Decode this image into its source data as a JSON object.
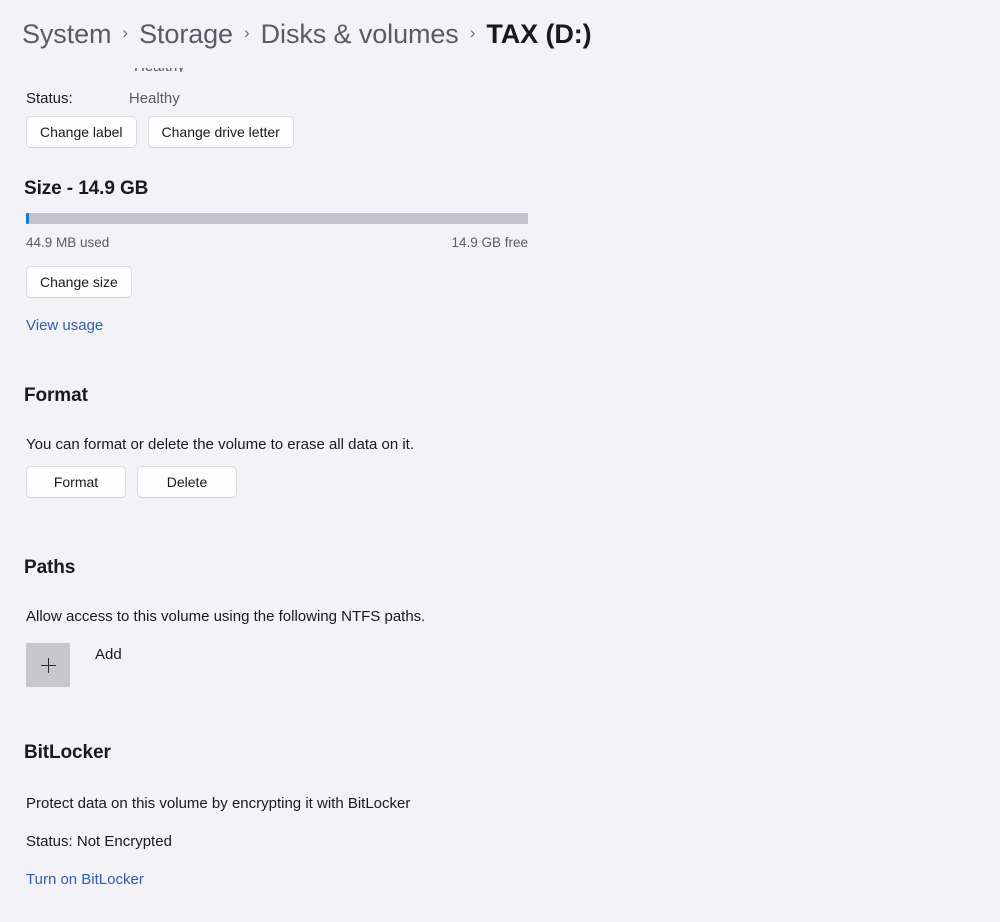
{
  "breadcrumb": {
    "separator": "›",
    "items": [
      {
        "label": "System",
        "current": false
      },
      {
        "label": "Storage",
        "current": false
      },
      {
        "label": "Disks & volumes",
        "current": false
      },
      {
        "label": "TAX (D:)",
        "current": true
      }
    ]
  },
  "volume": {
    "status_label": "Status:",
    "status_value": "Healthy",
    "change_label_button": "Change label",
    "change_drive_letter_button": "Change drive letter"
  },
  "size": {
    "heading": "Size - 14.9 GB",
    "total": "14.9 GB",
    "used_text": "44.9 MB used",
    "free_text": "14.9 GB free",
    "used_percent": 0.3,
    "change_size_button": "Change size",
    "view_usage_link": "View usage"
  },
  "format": {
    "heading": "Format",
    "description": "You can format or delete the volume to erase all data on it.",
    "format_button": "Format",
    "delete_button": "Delete"
  },
  "paths": {
    "heading": "Paths",
    "description": "Allow access to this volume using the following NTFS paths.",
    "add_label": "Add"
  },
  "bitlocker": {
    "heading": "BitLocker",
    "description": "Protect data on this volume by encrypting it with BitLocker",
    "status": "Status: Not Encrypted",
    "turn_on_link": "Turn on BitLocker"
  },
  "colors": {
    "page_background": "#f2f2f7",
    "accent_blue": "#0d7fd4",
    "link_blue": "#2f5fad",
    "bar_track": "#c3c3c9",
    "tile_gray": "#c8c8cc",
    "text_primary": "#1a1a1a",
    "text_secondary": "#5d5d5d"
  }
}
